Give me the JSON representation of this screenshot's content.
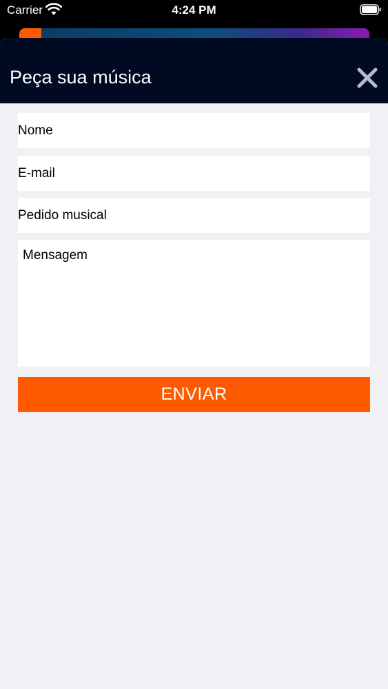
{
  "status_bar": {
    "carrier": "Carrier",
    "time": "4:24 PM",
    "wifi_icon": "wifi-icon",
    "battery_icon": "battery-icon"
  },
  "modal": {
    "title": "Peça sua música",
    "close_icon": "close-icon"
  },
  "form": {
    "nome_placeholder": "Nome",
    "email_placeholder": "E-mail",
    "pedido_placeholder": "Pedido musical",
    "mensagem_placeholder": "Mensagem",
    "submit_label": "ENVIAR"
  },
  "colors": {
    "header_bg": "#000a23",
    "accent": "#ff5a00",
    "sheet_bg": "#f0f0f5"
  }
}
